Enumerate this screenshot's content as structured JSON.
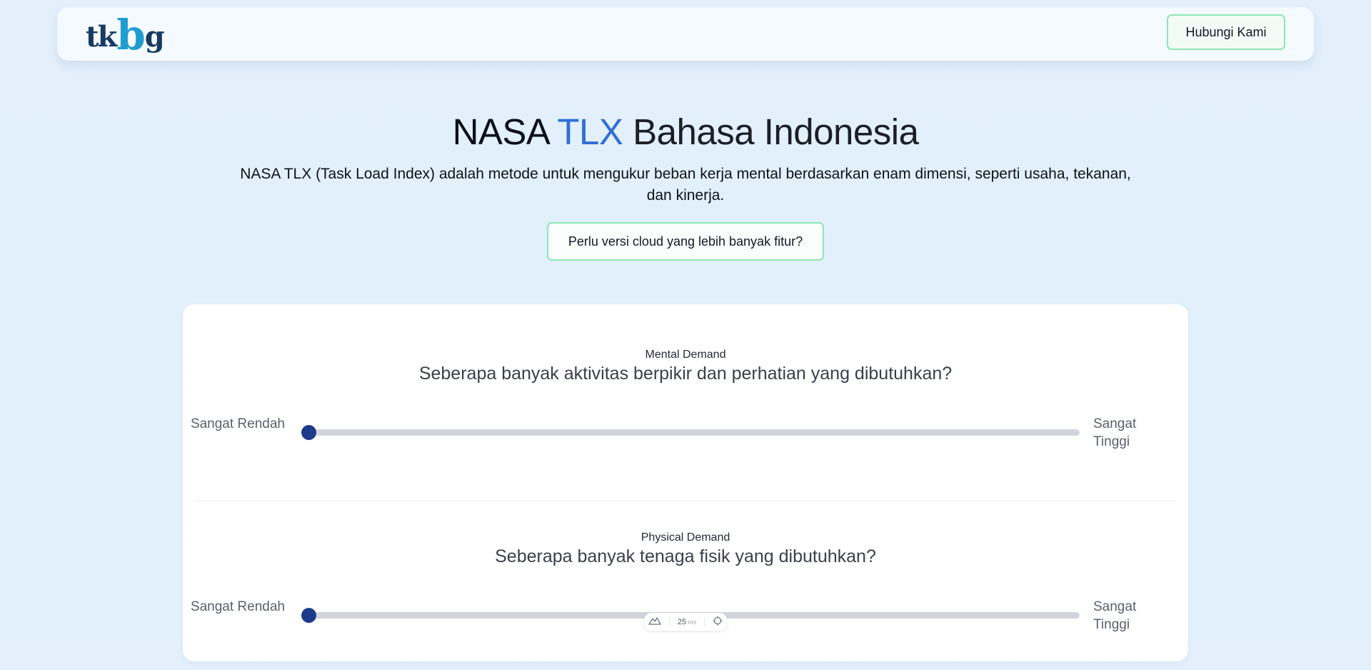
{
  "navbar": {
    "logo": {
      "part1": "tk",
      "part2": "b",
      "part3": "g"
    },
    "contact_label": "Hubungi Kami"
  },
  "hero": {
    "title_part1": "NASA",
    "title_part2": "TLX",
    "title_part3": "Bahasa Indonesia",
    "description": "NASA TLX (Task Load Index) adalah metode untuk mengukur beban kerja mental berdasarkan enam dimensi, seperti usaha, tekanan, dan kinerja.",
    "cloud_button_label": "Perlu versi cloud yang lebih banyak fitur?"
  },
  "questions": [
    {
      "dimension": "Mental Demand",
      "question": "Seberapa banyak aktivitas berpikir dan perhatian yang dibutuhkan?",
      "low_label": "Sangat Rendah",
      "high_label": "Sangat Tinggi",
      "value": 0
    },
    {
      "dimension": "Physical Demand",
      "question": "Seberapa banyak tenaga fisik yang dibutuhkan?",
      "low_label": "Sangat Rendah",
      "high_label": "Sangat Tinggi",
      "value": 0
    }
  ],
  "toolbar": {
    "value": "25",
    "unit": "ms"
  },
  "colors": {
    "accent": "#2f6ed6",
    "slider_thumb": "#1e3a8a",
    "slider_track": "#d1d5db",
    "button_border": "#8de7b4",
    "logo_dark": "#163a63",
    "logo_light": "#1f9dd0"
  }
}
